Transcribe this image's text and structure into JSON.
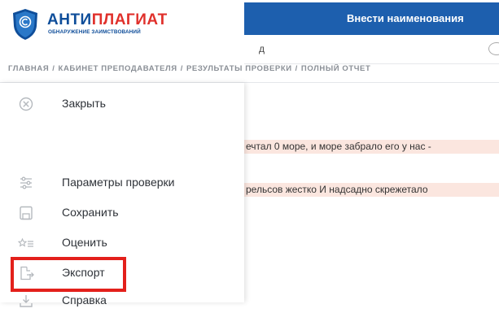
{
  "brand": {
    "title_part1": "АНТИ",
    "title_part2": "ПЛАГИАТ",
    "subtitle": "ОБНАРУЖЕНИЕ ЗАИМСТВОВАНИЙ",
    "colors": {
      "blue": "#0f4e9a",
      "red": "#e0312c",
      "accent_bar": "#1d5fae",
      "highlight": "#e3201b"
    }
  },
  "breadcrumb": {
    "separator": "/",
    "items": [
      "ГЛАВНАЯ",
      "КАБИНЕТ ПРЕПОДАВАТЕЛЯ",
      "РЕЗУЛЬТАТЫ ПРОВЕРКИ",
      "ПОЛНЫЙ ОТЧЕТ"
    ]
  },
  "menu": {
    "items": [
      {
        "icon": "close-circle-icon",
        "label": "Закрыть"
      },
      {
        "icon": "sliders-icon",
        "label": "Параметры проверки"
      },
      {
        "icon": "save-icon",
        "label": "Сохранить"
      },
      {
        "icon": "star-rate-icon",
        "label": "Оценить"
      },
      {
        "icon": "export-icon",
        "label": "Экспорт"
      },
      {
        "icon": "download-icon",
        "label": "Справка"
      }
    ]
  },
  "content": {
    "bar_label": "Внести наименования",
    "sub_text": "д",
    "line1": "ечтал 0 море, и море забрало его у нас -",
    "line2": "рельсов жестко И надсадно скрежетало"
  }
}
